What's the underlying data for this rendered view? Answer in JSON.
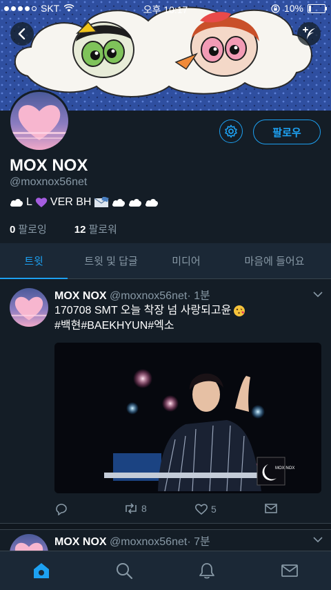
{
  "status_bar": {
    "carrier": "SKT",
    "time": "오후 10:17",
    "battery": "10%",
    "signal_bars": 4
  },
  "profile": {
    "name": "MOX NOX",
    "handle": "@moxnox56net",
    "bio_text": "L",
    "bio_text2": "VER BH",
    "follow_label": "팔로우",
    "following_count": "0",
    "following_label": "팔로잉",
    "followers_count": "12",
    "followers_label": "팔로워"
  },
  "tabs": [
    {
      "label": "트윗",
      "active": true
    },
    {
      "label": "트윗 및 답글",
      "active": false
    },
    {
      "label": "미디어",
      "active": false
    },
    {
      "label": "마음에 들어요",
      "active": false
    }
  ],
  "tweets": [
    {
      "name": "MOX NOX",
      "handle": "@moxnox56net",
      "time": "· 1분",
      "text_line1": "170708 SMT 오늘 착장 넘 사랑되고윤",
      "text_line2": "#백현#BAEKHYUN#엑소",
      "media_watermark": "MOX NOX",
      "retweets": "8",
      "likes": "5"
    },
    {
      "name": "MOX NOX",
      "handle": "@moxnox56net",
      "time": "· 7분"
    }
  ],
  "colors": {
    "background": "#141d26",
    "surface": "#1b2836",
    "accent": "#1da1f2",
    "muted": "#8899a6"
  }
}
